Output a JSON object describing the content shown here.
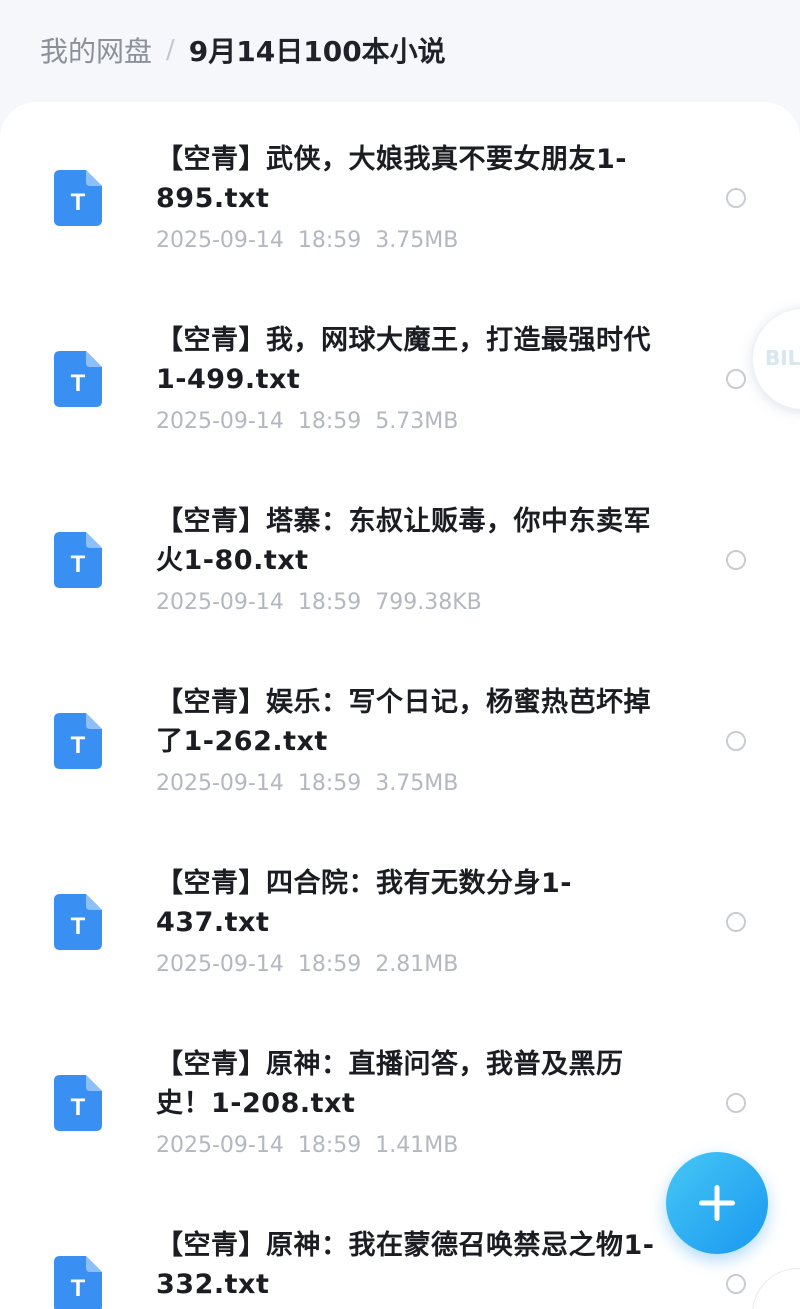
{
  "breadcrumb": {
    "root": "我的网盘",
    "separator": "/",
    "current": "9月14日100本小说"
  },
  "files": [
    {
      "name": "【空青】武侠，大娘我真不要女朋友1-895.txt",
      "date": "2025-09-14",
      "time": "18:59",
      "size": "3.75MB",
      "icon": "txt-file-icon"
    },
    {
      "name": "【空青】我，网球大魔王，打造最强时代1-499.txt",
      "date": "2025-09-14",
      "time": "18:59",
      "size": "5.73MB",
      "icon": "txt-file-icon"
    },
    {
      "name": "【空青】塔寨：东叔让贩毒，你中东卖军火1-80.txt",
      "date": "2025-09-14",
      "time": "18:59",
      "size": "799.38KB",
      "icon": "txt-file-icon"
    },
    {
      "name": "【空青】娱乐：写个日记，杨蜜热芭坏掉了1-262.txt",
      "date": "2025-09-14",
      "time": "18:59",
      "size": "3.75MB",
      "icon": "txt-file-icon"
    },
    {
      "name": "【空青】四合院：我有无数分身1-437.txt",
      "date": "2025-09-14",
      "time": "18:59",
      "size": "2.81MB",
      "icon": "txt-file-icon"
    },
    {
      "name": "【空青】原神：直播问答，我普及黑历史！1-208.txt",
      "date": "2025-09-14",
      "time": "18:59",
      "size": "1.41MB",
      "icon": "txt-file-icon"
    },
    {
      "name": "【空青】原神：我在蒙德召唤禁忌之物1-332.txt",
      "date": "",
      "time": "",
      "size": "",
      "icon": "txt-file-icon"
    }
  ],
  "floating_badge": {
    "text": "BIL"
  },
  "fab": {
    "icon": "plus-icon"
  },
  "colors": {
    "accent": "#1a97f0",
    "icon_blue": "#3a8ff2",
    "meta_gray": "#b3b7bf"
  }
}
